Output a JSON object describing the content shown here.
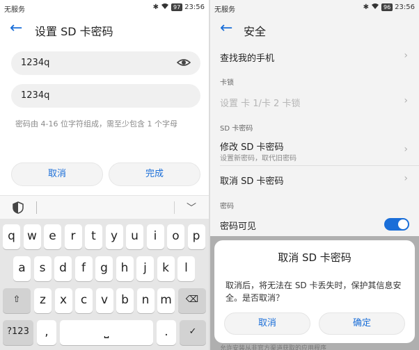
{
  "left": {
    "status": {
      "carrier": "无服务",
      "bluetooth": "✱",
      "battery": "97",
      "time": "23:56"
    },
    "header": {
      "title": "设置 SD 卡密码"
    },
    "password_field": {
      "value": "1234q"
    },
    "confirm_field": {
      "value": "1234q"
    },
    "hint": "密码由 4-16 位字符组成，需至少包含 1 个字母",
    "cancel_label": "取消",
    "done_label": "完成",
    "keyboard": {
      "row1": [
        "q",
        "w",
        "e",
        "r",
        "t",
        "y",
        "u",
        "i",
        "o",
        "p"
      ],
      "row2": [
        "a",
        "s",
        "d",
        "f",
        "g",
        "h",
        "j",
        "k",
        "l"
      ],
      "row3": [
        "z",
        "x",
        "c",
        "v",
        "b",
        "n",
        "m"
      ],
      "shift_icon": "⇧",
      "backspace_icon": "⌫",
      "symbols_label": "?123",
      "comma_label": ",",
      "period_label": ".",
      "enter_icon": "✓",
      "space_icon": "⎵"
    }
  },
  "right": {
    "status": {
      "carrier": "无服务",
      "bluetooth": "✱",
      "battery": "96",
      "time": "23:56"
    },
    "header": {
      "title": "安全"
    },
    "find_phone": "查找我的手机",
    "section_card_lock": "卡锁",
    "set_card_lock": "设置 卡 1/卡 2 卡锁",
    "section_sd_password": "SD 卡密码",
    "modify_sd": "修改 SD 卡密码",
    "modify_sd_sub": "设置新密码，取代旧密码",
    "cancel_sd": "取消 SD 卡密码",
    "section_password": "密码",
    "password_visible": "密码可见",
    "password_visible_on": true,
    "dialog": {
      "title": "取消 SD 卡密码",
      "message": "取消后，将无法在 SD 卡丢失时，保护其信息安全。是否取消？",
      "cancel_label": "取消",
      "confirm_label": "确定"
    },
    "footer_peek": "允许安装从非官方渠道获取的应用程序"
  },
  "colors": {
    "accent": "#1a6ed8"
  }
}
